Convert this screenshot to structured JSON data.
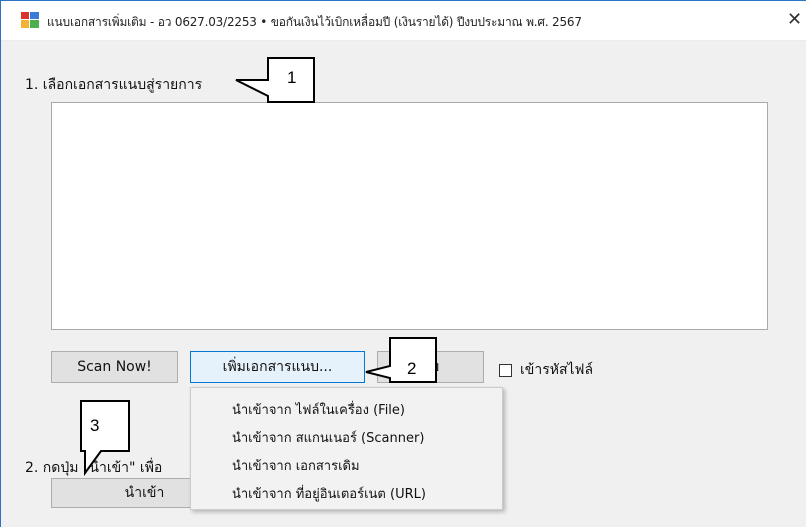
{
  "window": {
    "title": "แนบเอกสารเพิ่มเติม - อว 0627.03/2253 • ขอกันเงินไว้เบิกเหลื่อมปี (เงินรายได้) ปีงบประมาณ พ.ศ. 2567",
    "close_glyph": "✕"
  },
  "section1": {
    "label": "1. เลือกเอกสารแนบสู่รายการ"
  },
  "toolbar": {
    "scan_label": "Scan Now!",
    "add_label": "เพิ่มเอกสารแนบ...",
    "delete_label": "ลบ",
    "encrypt_label": "เข้ารหัสไฟล์"
  },
  "menu": {
    "items": [
      "นำเข้าจาก ไฟล์ในเครื่อง (File)",
      "นำเข้าจาก สแกนเนอร์ (Scanner)",
      "นำเข้าจาก เอกสารเดิม",
      "นำเข้าจาก ที่อยู่อินเตอร์เนต (URL)"
    ]
  },
  "section2": {
    "label": "2. กดปุ่ม \"นำเข้า\" เพื่อ"
  },
  "import_button": {
    "label": "นำเข้า"
  },
  "callouts": [
    "1",
    "2",
    "3"
  ],
  "colors": {
    "accent": "#0078d7",
    "window_border": "#2b73c4"
  }
}
